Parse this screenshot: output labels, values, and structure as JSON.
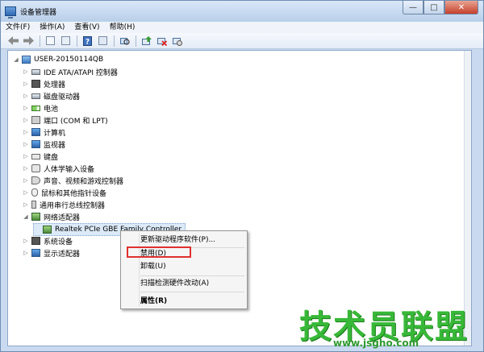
{
  "window": {
    "title": "设备管理器",
    "controls": {
      "minimize": "—",
      "maximize": "□",
      "close": "✕"
    }
  },
  "menubar": [
    "文件(F)",
    "操作(A)",
    "查看(V)",
    "帮助(H)"
  ],
  "toolbar": {
    "icons": [
      "back-icon",
      "forward-icon",
      "properties-icon",
      "show-hide-icon",
      "help-icon",
      "view-icon",
      "scan-icon",
      "update-driver-icon",
      "disable-icon",
      "uninstall-icon"
    ]
  },
  "tree": {
    "root": "USER-20150114QB",
    "categories": [
      {
        "label": "IDE ATA/ATAPI 控制器",
        "icon": "drive-icon"
      },
      {
        "label": "处理器",
        "icon": "chip-icon"
      },
      {
        "label": "磁盘驱动器",
        "icon": "drive-icon"
      },
      {
        "label": "电池",
        "icon": "battery-icon"
      },
      {
        "label": "端口 (COM 和 LPT)",
        "icon": "port-icon"
      },
      {
        "label": "计算机",
        "icon": "monitor-icon"
      },
      {
        "label": "监视器",
        "icon": "monitor-icon"
      },
      {
        "label": "键盘",
        "icon": "keyboard-icon"
      },
      {
        "label": "人体学输入设备",
        "icon": "hid-icon"
      },
      {
        "label": "声音、视频和游戏控制器",
        "icon": "sound-icon"
      },
      {
        "label": "鼠标和其他指针设备",
        "icon": "mouse-icon"
      },
      {
        "label": "通用串行总线控制器",
        "icon": "usb-icon"
      },
      {
        "label": "网络适配器",
        "icon": "network-icon",
        "expanded": true
      },
      {
        "label": "Realtek PCIe GBE Family Controller",
        "icon": "network-icon",
        "child": true,
        "selected": true
      },
      {
        "label": "系统设备",
        "icon": "chip-icon"
      },
      {
        "label": "显示适配器",
        "icon": "display-icon"
      }
    ]
  },
  "context_menu": {
    "items": [
      "更新驱动程序软件(P)...",
      "禁用(D)",
      "卸载(U)",
      "扫描检测硬件改动(A)",
      "属性(R)"
    ],
    "highlighted": "禁用(D)"
  },
  "watermark": {
    "text": "技术员联盟",
    "url": "www.jsgho.com"
  },
  "colors": {
    "highlight_border": "#e0302e",
    "watermark": "#38b838",
    "title_bar": "#c9daf0"
  }
}
